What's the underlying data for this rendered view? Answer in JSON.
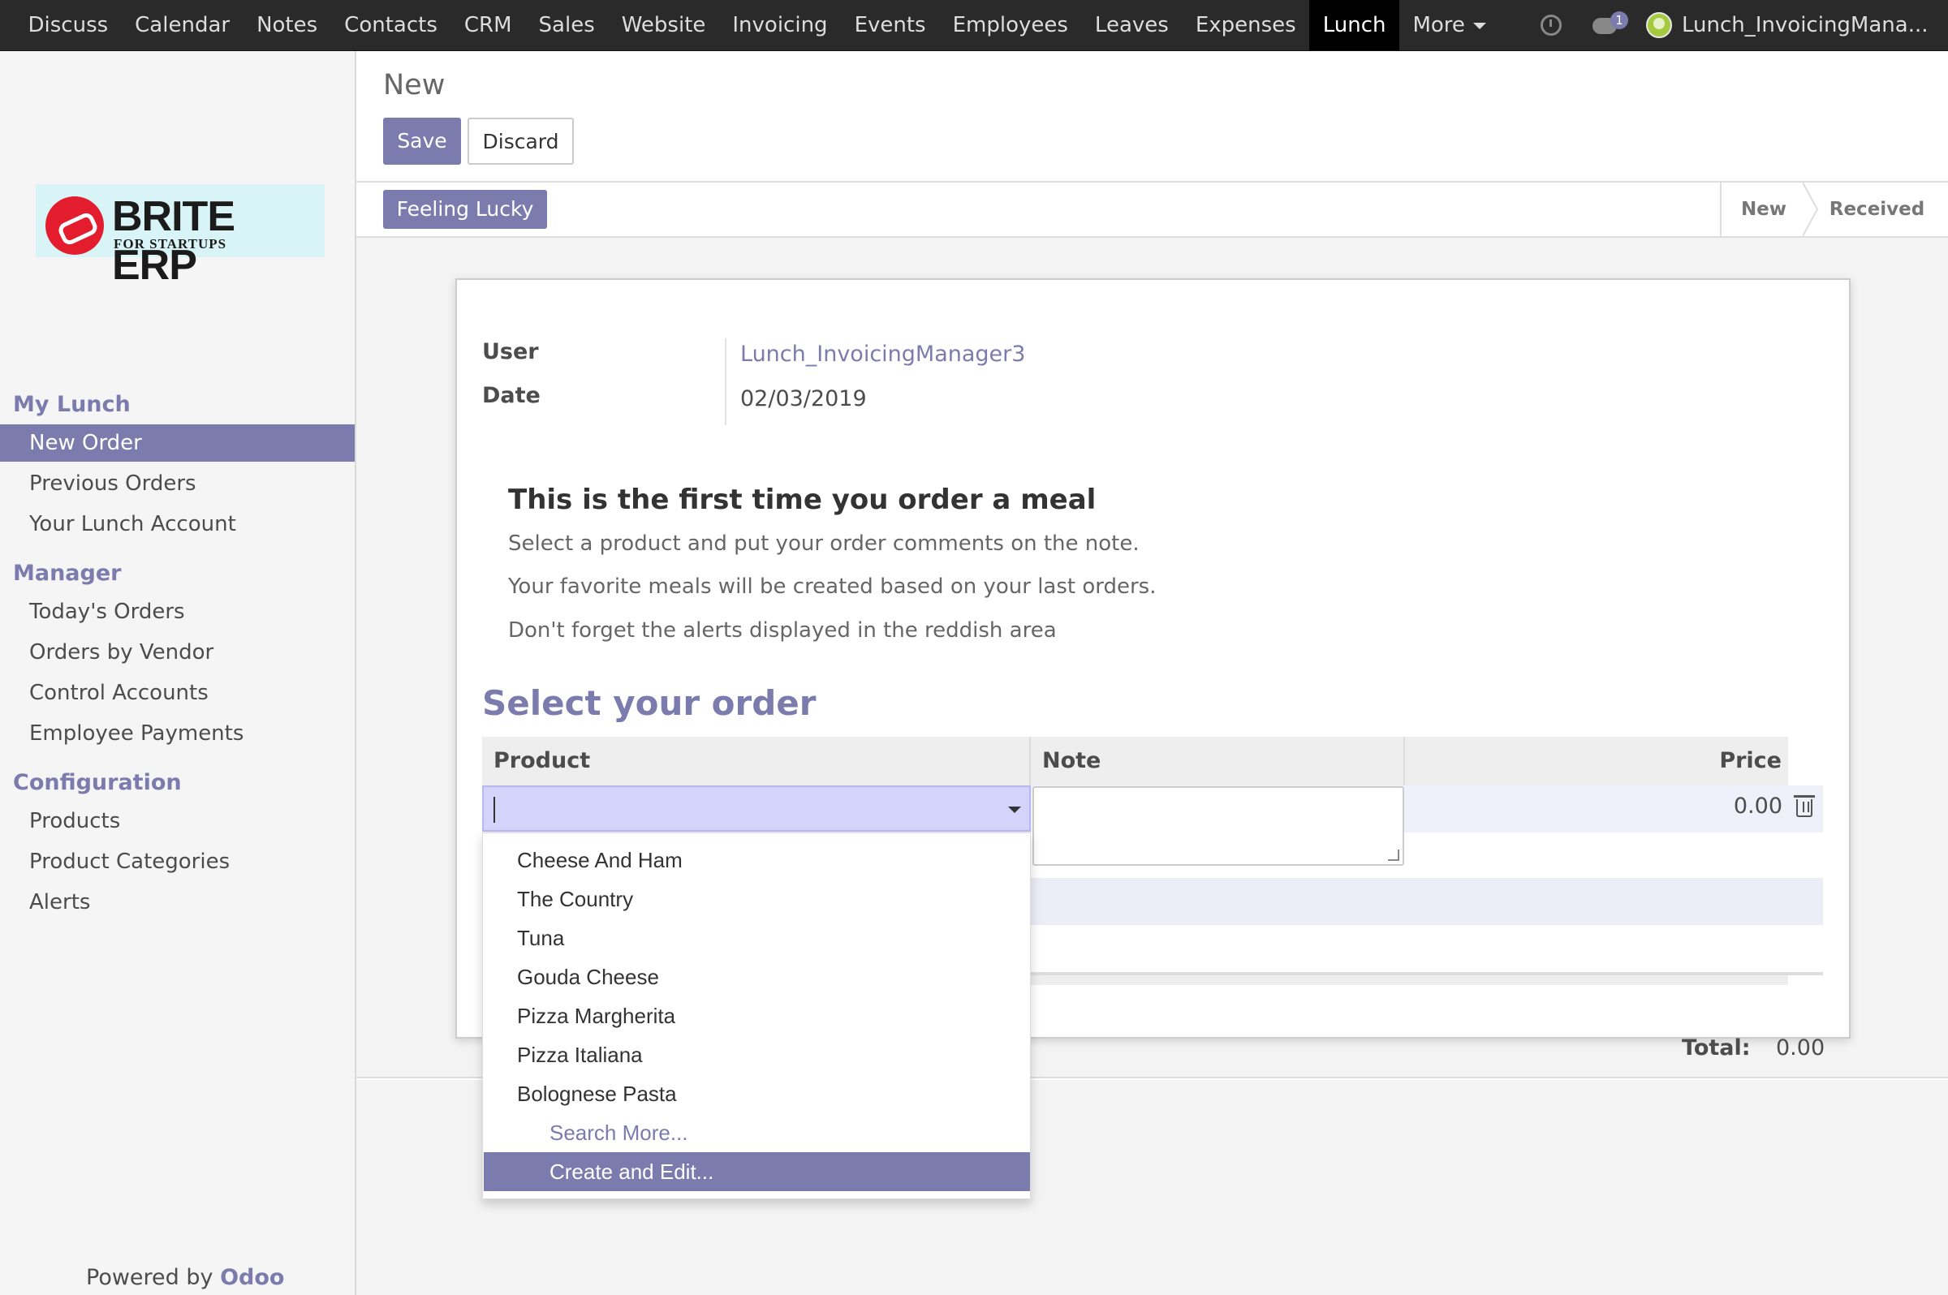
{
  "topbar": {
    "menu": [
      "Discuss",
      "Calendar",
      "Notes",
      "Contacts",
      "CRM",
      "Sales",
      "Website",
      "Invoicing",
      "Events",
      "Employees",
      "Leaves",
      "Expenses",
      "Lunch"
    ],
    "more_label": "More",
    "active_menu": "Lunch",
    "chat_badge": "1",
    "user": "Lunch_InvoicingMana..."
  },
  "logo": {
    "brand": "BRITE ERP",
    "tagline": "FOR STARTUPS"
  },
  "sidebar": {
    "sections": [
      {
        "title": "My Lunch",
        "items": [
          "New Order",
          "Previous Orders",
          "Your Lunch Account"
        ]
      },
      {
        "title": "Manager",
        "items": [
          "Today's Orders",
          "Orders by Vendor",
          "Control Accounts",
          "Employee Payments"
        ]
      },
      {
        "title": "Configuration",
        "items": [
          "Products",
          "Product Categories",
          "Alerts"
        ]
      }
    ],
    "active_item": "New Order",
    "powered_prefix": "Powered by",
    "powered_brand": "Odoo"
  },
  "control": {
    "breadcrumb": "New",
    "save_label": "Save",
    "discard_label": "Discard"
  },
  "statusbar": {
    "lucky_label": "Feeling Lucky",
    "stages": [
      "New",
      "Received"
    ]
  },
  "form": {
    "user_label": "User",
    "user_value": "Lunch_InvoicingManager3",
    "date_label": "Date",
    "date_value": "02/03/2019",
    "help_title": "This is the first time you order a meal",
    "help_lines": [
      "Select a product and put your order comments on the note.",
      "Your favorite meals will be created based on your last orders.",
      "Don't forget the alerts displayed in the reddish area"
    ],
    "section_title": "Select your order",
    "columns": {
      "product": "Product",
      "note": "Note",
      "price": "Price"
    },
    "row_price": "0.00",
    "total_label": "Total:",
    "total_value": "0.00"
  },
  "dropdown": {
    "options": [
      "Cheese And Ham",
      "The Country",
      "Tuna",
      "Gouda Cheese",
      "Pizza Margherita",
      "Pizza Italiana",
      "Bolognese Pasta"
    ],
    "search_more": "Search More...",
    "create_edit": "Create and Edit..."
  },
  "colors": {
    "accent": "#7c7bad",
    "topbar": "#2a2a2a",
    "input_highlight": "#d4d4fb"
  }
}
